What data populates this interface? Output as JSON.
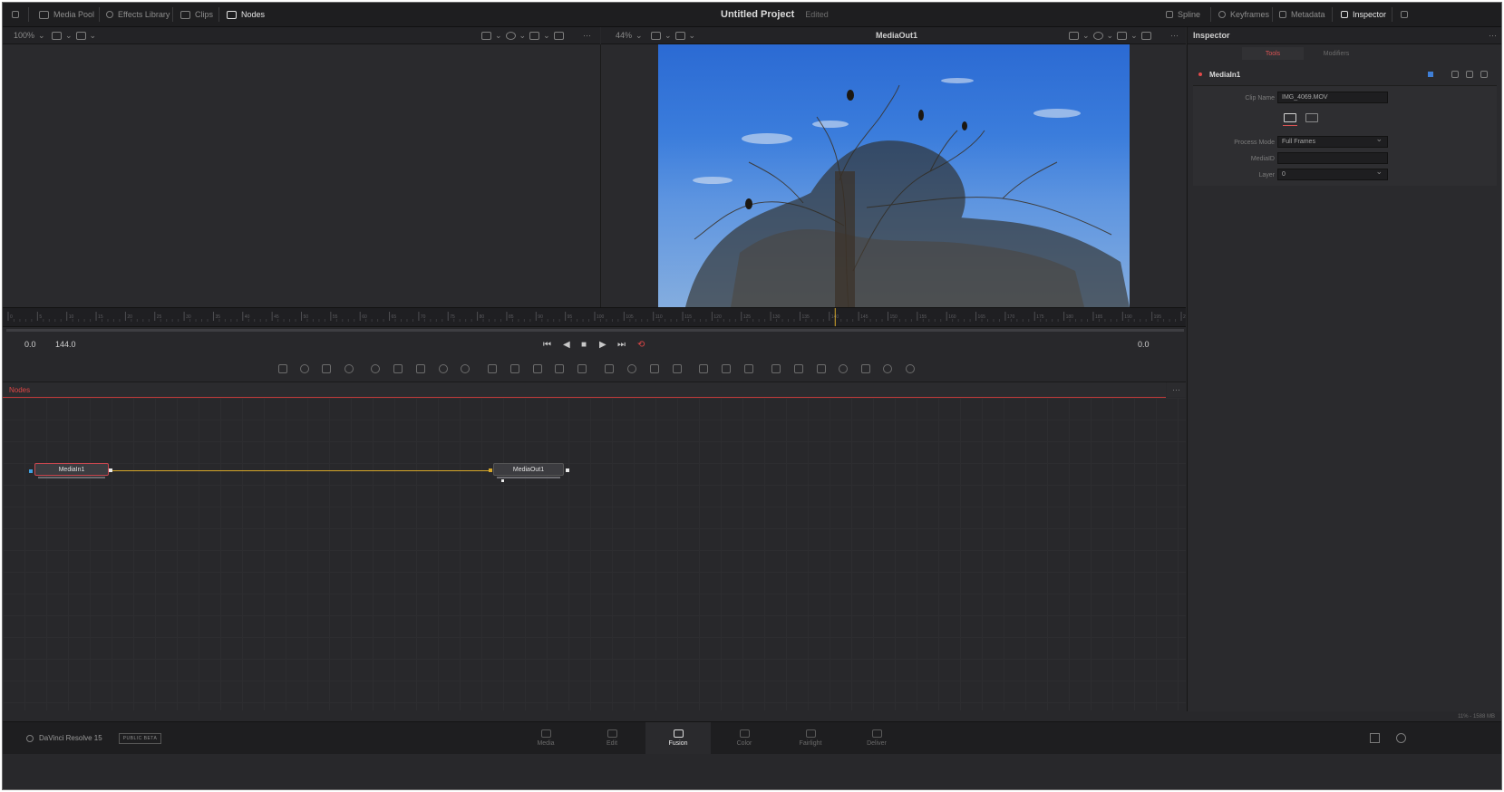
{
  "topbar": {
    "left_items": [
      {
        "label": "Media Pool",
        "icon": "media-pool-icon"
      },
      {
        "label": "Effects Library",
        "icon": "effects-library-icon"
      },
      {
        "label": "Clips",
        "icon": "clips-icon"
      },
      {
        "label": "Nodes",
        "icon": "nodes-icon"
      }
    ],
    "project_title": "Untitled Project",
    "project_status": "Edited",
    "right_items": [
      {
        "label": "Spline",
        "icon": "spline-icon"
      },
      {
        "label": "Keyframes",
        "icon": "keyframes-icon"
      },
      {
        "label": "Metadata",
        "icon": "metadata-icon"
      },
      {
        "label": "Inspector",
        "icon": "inspector-icon"
      }
    ]
  },
  "viewer_left": {
    "zoom": "100%"
  },
  "viewer_right": {
    "zoom": "44%",
    "title": "MediaOut1"
  },
  "ruler": {
    "labels": [
      "0",
      "5",
      "10",
      "15",
      "20",
      "25",
      "30",
      "35",
      "40",
      "45",
      "50",
      "55",
      "60",
      "65",
      "70",
      "75",
      "80",
      "85",
      "90",
      "95",
      "100",
      "105",
      "110",
      "115",
      "120",
      "125",
      "130",
      "135",
      "140",
      "145",
      "150",
      "155",
      "160",
      "165",
      "170",
      "175",
      "180",
      "185",
      "190",
      "195",
      "200"
    ],
    "playhead_frame": "141"
  },
  "transport": {
    "start": "0.0",
    "end": "144.0",
    "current": "0.0"
  },
  "nodes": {
    "header": "Nodes",
    "more": "···",
    "items": [
      {
        "id": "media-in",
        "label": "MediaIn1"
      },
      {
        "id": "media-out",
        "label": "MediaOut1"
      }
    ]
  },
  "inspector": {
    "title": "Inspector",
    "more": "···",
    "tabs": [
      "Tools",
      "Modifiers"
    ],
    "node_name": "MediaIn1",
    "fields": [
      {
        "label": "Clip Name",
        "value": "IMG_4069.MOV",
        "dropdown": false
      },
      {
        "label": "Process Mode",
        "value": "Full Frames",
        "dropdown": true
      },
      {
        "label": "MediaID",
        "value": "",
        "dropdown": false
      },
      {
        "label": "Layer",
        "value": "0",
        "dropdown": true
      }
    ]
  },
  "status": {
    "memory": "11% - 1588 MB"
  },
  "pagebar": {
    "brand": "DaVinci Resolve 15",
    "beta": "PUBLIC BETA",
    "pages": [
      {
        "label": "Media",
        "icon": "media-page-icon"
      },
      {
        "label": "Edit",
        "icon": "edit-page-icon"
      },
      {
        "label": "Fusion",
        "icon": "fusion-page-icon",
        "active": true
      },
      {
        "label": "Color",
        "icon": "color-page-icon"
      },
      {
        "label": "Fairlight",
        "icon": "fairlight-page-icon"
      },
      {
        "label": "Deliver",
        "icon": "deliver-page-icon"
      }
    ]
  },
  "colors": {
    "accent_red": "#d95353",
    "link_yellow": "#d6a72a",
    "background": "#28282b"
  }
}
